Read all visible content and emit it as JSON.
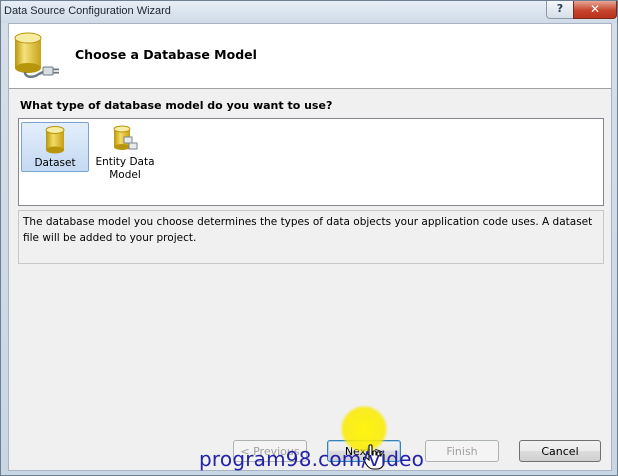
{
  "window": {
    "title": "Data Source Configuration Wizard",
    "help_glyph": "?",
    "close_glyph": "✕"
  },
  "header": {
    "title": "Choose a Database Model",
    "icon": "database-plug-icon"
  },
  "question": "What type of database model do you want to use?",
  "models": [
    {
      "label": "Dataset",
      "icon": "dataset-database-icon",
      "selected": true
    },
    {
      "label": "Entity Data Model",
      "icon": "entity-data-model-icon",
      "selected": false
    }
  ],
  "description": "The database model you choose determines the types of data objects your application code uses. A dataset file will be added to your project.",
  "buttons": {
    "previous": "< Previous",
    "next": "Next >",
    "finish": "Finish",
    "cancel": "Cancel"
  },
  "watermark": "program98.com/video",
  "colors": {
    "selection": "#c4d9f3",
    "close_button": "#c7442c",
    "cursor_highlight": "#faeb00",
    "watermark": "#2222aa"
  }
}
